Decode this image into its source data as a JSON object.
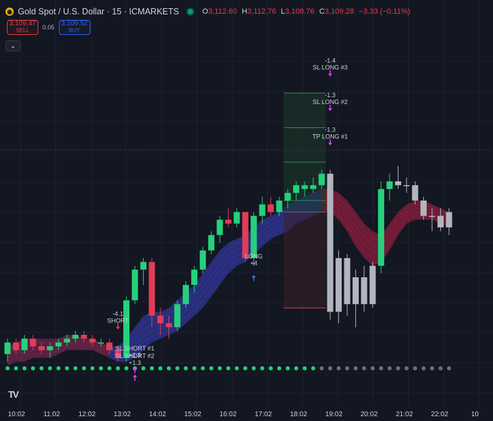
{
  "header": {
    "symbol": "Gold Spot / U.S. Dollar · 15 · ICMARKETS",
    "coin_icon": "gold-coin-icon",
    "status_dot_color": "#089981",
    "o_label": "O",
    "o_value": "3,112.60",
    "h_label": "H",
    "h_value": "3,112.76",
    "l_label": "L",
    "l_value": "3,108.76",
    "c_label": "C",
    "c_value": "3,109.28",
    "change": "−3.33 (−0.11%)"
  },
  "trade": {
    "sell_price": "3,109.47",
    "sell_label": "SELL",
    "spread": "0.05",
    "buy_price": "3,109.52",
    "buy_label": "BUY"
  },
  "collapse_icon": "chevron-down-icon",
  "tv_logo": "TV",
  "colors": {
    "bg": "#131722",
    "up": "#26d07c",
    "down": "#e23c57",
    "neutral": "#b2b5be",
    "magenta": "#e040fb",
    "blue": "#2979ff"
  },
  "chart_data": {
    "type": "candlestick",
    "x_ticks": [
      "10:02",
      "11:02",
      "12:02",
      "13:02",
      "14:02",
      "15:02",
      "16:02",
      "17:02",
      "18:02",
      "19:02",
      "20:02",
      "21:02",
      "22:02",
      "10"
    ],
    "candles": [
      [
        3097,
        3101,
        3095,
        3100,
        "up"
      ],
      [
        3100,
        3101,
        3097,
        3098,
        "down"
      ],
      [
        3098,
        3102,
        3097,
        3101,
        "up"
      ],
      [
        3101,
        3102,
        3098,
        3099,
        "down"
      ],
      [
        3099,
        3100,
        3097,
        3098,
        "down"
      ],
      [
        3098,
        3100,
        3096,
        3099,
        "up"
      ],
      [
        3099,
        3101,
        3098,
        3100,
        "up"
      ],
      [
        3100,
        3102,
        3099,
        3101,
        "up"
      ],
      [
        3101,
        3103,
        3100,
        3102,
        "up"
      ],
      [
        3102,
        3103,
        3100,
        3101,
        "down"
      ],
      [
        3101,
        3102,
        3099,
        3100,
        "down"
      ],
      [
        3100,
        3101,
        3099,
        3100,
        "up"
      ],
      [
        3100,
        3101,
        3097,
        3098,
        "down"
      ],
      [
        3098,
        3099,
        3095,
        3096,
        "down"
      ],
      [
        3096,
        3112,
        3095,
        3111,
        "up"
      ],
      [
        3111,
        3120,
        3110,
        3119,
        "up"
      ],
      [
        3119,
        3122,
        3115,
        3121,
        "up"
      ],
      [
        3121,
        3122,
        3104,
        3107,
        "down"
      ],
      [
        3107,
        3109,
        3102,
        3105,
        "down"
      ],
      [
        3105,
        3107,
        3101,
        3104,
        "down"
      ],
      [
        3104,
        3111,
        3103,
        3110,
        "up"
      ],
      [
        3110,
        3116,
        3109,
        3115,
        "up"
      ],
      [
        3115,
        3120,
        3113,
        3119,
        "up"
      ],
      [
        3119,
        3125,
        3118,
        3124,
        "up"
      ],
      [
        3124,
        3129,
        3123,
        3128,
        "up"
      ],
      [
        3128,
        3133,
        3126,
        3132,
        "up"
      ],
      [
        3132,
        3135,
        3130,
        3131,
        "down"
      ],
      [
        3131,
        3135,
        3130,
        3134,
        "up"
      ],
      [
        3134,
        3134,
        3121,
        3122,
        "down"
      ],
      [
        3122,
        3134,
        3120,
        3133,
        "up"
      ],
      [
        3133,
        3138,
        3131,
        3136,
        "up"
      ],
      [
        3136,
        3138,
        3133,
        3134,
        "down"
      ],
      [
        3134,
        3138,
        3133,
        3137,
        "up"
      ],
      [
        3137,
        3140,
        3135,
        3139,
        "up"
      ],
      [
        3139,
        3142,
        3137,
        3141,
        "up"
      ],
      [
        3141,
        3142,
        3138,
        3140,
        "up"
      ],
      [
        3140,
        3143,
        3139,
        3141,
        "up"
      ],
      [
        3141,
        3145,
        3140,
        3144,
        "up"
      ],
      [
        3144,
        3145,
        3106,
        3108,
        "neutral"
      ],
      [
        3108,
        3124,
        3105,
        3122,
        "neutral"
      ],
      [
        3122,
        3123,
        3107,
        3110,
        "neutral"
      ],
      [
        3110,
        3119,
        3104,
        3117,
        "neutral"
      ],
      [
        3117,
        3120,
        3108,
        3110,
        "neutral"
      ],
      [
        3110,
        3121,
        3109,
        3120,
        "neutral"
      ],
      [
        3120,
        3142,
        3118,
        3140,
        "up"
      ],
      [
        3140,
        3144,
        3137,
        3142,
        "up"
      ],
      [
        3142,
        3146,
        3140,
        3141,
        "neutral"
      ],
      [
        3141,
        3143,
        3139,
        3141,
        "neutral"
      ],
      [
        3141,
        3142,
        3136,
        3137,
        "neutral"
      ],
      [
        3137,
        3138,
        3132,
        3133,
        "neutral"
      ],
      [
        3133,
        3135,
        3129,
        3133,
        "neutral"
      ],
      [
        3133,
        3135,
        3129,
        3130,
        "neutral"
      ],
      [
        3130,
        3135,
        3128,
        3134,
        "neutral"
      ]
    ],
    "band": {
      "upper": [
        3099,
        3100,
        3101,
        3101,
        3101,
        3101,
        3101,
        3102,
        3102,
        3101,
        3101,
        3100,
        3099,
        3099,
        3101,
        3104,
        3107,
        3108,
        3108,
        3109,
        3111,
        3113,
        3115,
        3118,
        3121,
        3124,
        3126,
        3127,
        3128,
        3130,
        3132,
        3133,
        3134,
        3136,
        3137,
        3138,
        3139,
        3140,
        3140,
        3139,
        3137,
        3134,
        3131,
        3129,
        3128,
        3131,
        3134,
        3136,
        3137,
        3137,
        3136,
        3135,
        3134
      ],
      "lower": [
        3094,
        3095,
        3095,
        3096,
        3096,
        3096,
        3097,
        3098,
        3098,
        3098,
        3098,
        3097,
        3096,
        3095,
        3095,
        3096,
        3098,
        3100,
        3101,
        3102,
        3103,
        3105,
        3107,
        3109,
        3112,
        3115,
        3118,
        3120,
        3121,
        3123,
        3125,
        3127,
        3128,
        3129,
        3131,
        3132,
        3133,
        3134,
        3134,
        3132,
        3129,
        3125,
        3122,
        3120,
        3121,
        3124,
        3128,
        3131,
        3132,
        3132,
        3132,
        3131,
        3130
      ],
      "bearish_from_index": 37
    },
    "dots_green_until_index": 37,
    "position_zone": {
      "start_index": 33,
      "end_index": 37,
      "entry": 3134,
      "stop": 3109,
      "targets": [
        3137,
        3147,
        3156,
        3165
      ]
    },
    "annotations": [
      {
        "index": 13,
        "text_top": "-4.1",
        "text_bottom": "SHORT",
        "arrow": "down",
        "color": "#e23c57",
        "price": 3103
      },
      {
        "index": 15,
        "text_top": "SL SHORT #1",
        "text_bottom": "+1.3",
        "arrow": "up",
        "color": "#e040fb",
        "price": 3094
      },
      {
        "index": 15,
        "text_top": "SL SHORT #2",
        "text_bottom": "+1.3",
        "arrow": "up",
        "color": "#e040fb",
        "price": 3092
      },
      {
        "index": 29,
        "text_top": "LONG",
        "text_bottom": "+4",
        "arrow": "up",
        "color": "#2979ff",
        "price": 3118
      },
      {
        "index": 38,
        "text_top": "-1.3",
        "text_bottom": "TP LONG #1",
        "arrow": "down",
        "color": "#e040fb",
        "price": 3151
      },
      {
        "index": 38,
        "text_top": "-1.3",
        "text_bottom": "SL LONG #2",
        "arrow": "down",
        "color": "#e040fb",
        "price": 3160
      },
      {
        "index": 38,
        "text_top": "-1.4",
        "text_bottom": "SL LONG #3",
        "arrow": "down",
        "color": "#e040fb",
        "price": 3169
      }
    ],
    "y_range": [
      3084,
      3175
    ],
    "grid": true
  }
}
